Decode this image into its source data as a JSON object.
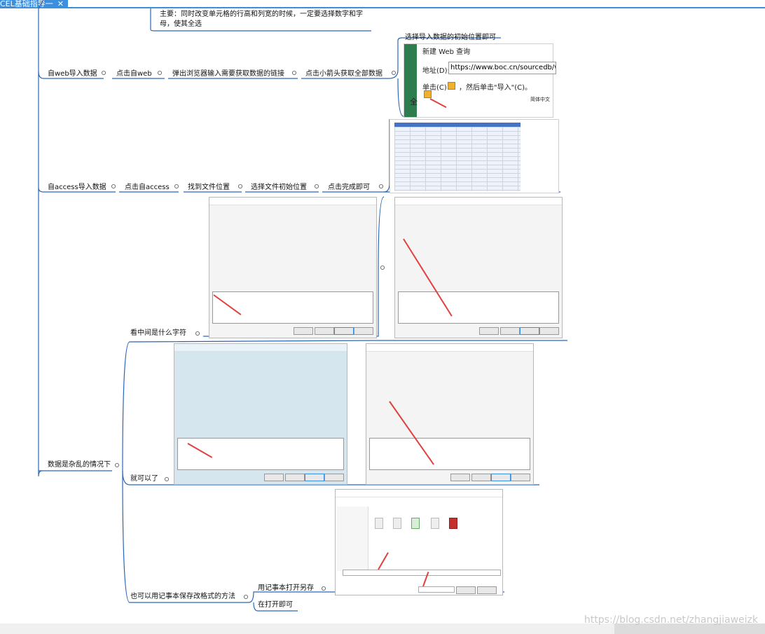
{
  "tab": {
    "title": "CEL基础指导一",
    "close": "✕"
  },
  "topnote": "主要：同时改变单元格的行高和列宽的时候，一定要选择数字和字母，使其全选",
  "web": {
    "root": "自web导入数据",
    "steps": [
      "点击自web",
      "弹出浏览器输入需要获取数据的链接",
      "点击小箭头获取全部数据"
    ],
    "caption": "选择导入数据的初始位置即可",
    "ie": {
      "title_fragment": "新建 Web 查询",
      "addr_label": "地址(D):",
      "addr_value": "https://www.boc.cn/sourcedb/wh",
      "click_prefix": "单击(C)",
      "click_suffix": "，然后单击\"导入\"(C)。",
      "side_char": "全",
      "lang": "简体中文"
    }
  },
  "access": {
    "root": "自access导入数据",
    "steps": [
      "点击自access",
      "找到文件位置",
      "选择文件初始位置",
      "点击完成即可"
    ]
  },
  "messy": {
    "root": "数据是杂乱的情况下",
    "branch1": "看中间是什么字符",
    "branch2": "就可以了",
    "branch3": "也可以用记事本保存改格式的方法",
    "sub3": [
      "用记事本打开另存",
      "在打开即可"
    ]
  },
  "watermark": "https://blog.csdn.net/zhangjiaweizk",
  "colors": {
    "accent": "#3c8fde",
    "line": "#2a66b8",
    "arrow": "#e04040"
  }
}
